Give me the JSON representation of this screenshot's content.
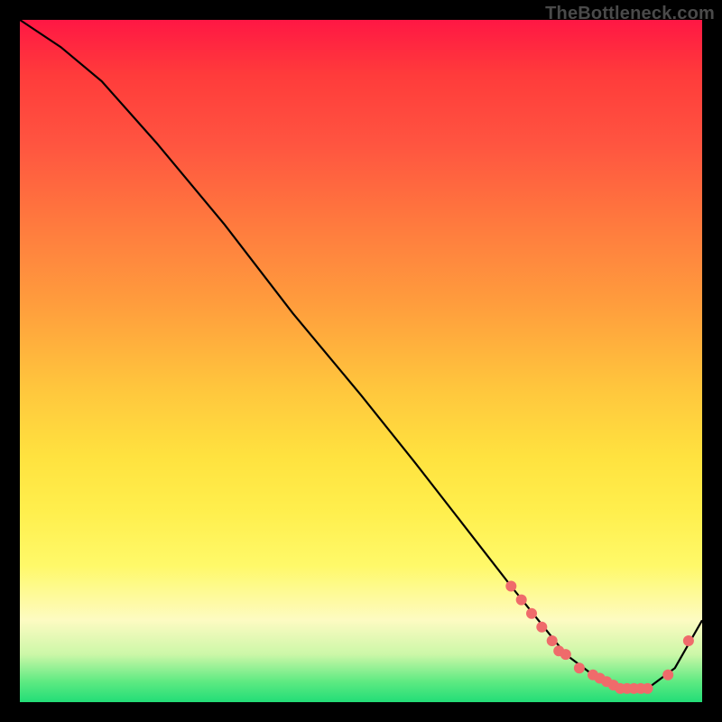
{
  "watermark": {
    "text": "TheBottleneck.com"
  },
  "chart_data": {
    "type": "line",
    "title": "",
    "xlabel": "",
    "ylabel": "",
    "xlim": [
      0,
      100
    ],
    "ylim": [
      0,
      100
    ],
    "series": [
      {
        "name": "curve",
        "x": [
          0,
          6,
          12,
          20,
          30,
          40,
          50,
          58,
          65,
          72,
          76,
          80,
          84,
          88,
          92,
          96,
          100
        ],
        "y": [
          100,
          96,
          91,
          82,
          70,
          57,
          45,
          35,
          26,
          17,
          12,
          7,
          4,
          2,
          2,
          5,
          12
        ]
      }
    ],
    "markers": [
      {
        "x": 72,
        "y": 17
      },
      {
        "x": 73.5,
        "y": 15
      },
      {
        "x": 75,
        "y": 13
      },
      {
        "x": 76.5,
        "y": 11
      },
      {
        "x": 78,
        "y": 9
      },
      {
        "x": 79,
        "y": 7.5
      },
      {
        "x": 80,
        "y": 7
      },
      {
        "x": 82,
        "y": 5
      },
      {
        "x": 84,
        "y": 4
      },
      {
        "x": 85,
        "y": 3.5
      },
      {
        "x": 86,
        "y": 3
      },
      {
        "x": 87,
        "y": 2.5
      },
      {
        "x": 88,
        "y": 2
      },
      {
        "x": 89,
        "y": 2
      },
      {
        "x": 90,
        "y": 2
      },
      {
        "x": 91,
        "y": 2
      },
      {
        "x": 92,
        "y": 2
      },
      {
        "x": 95,
        "y": 4
      },
      {
        "x": 98,
        "y": 9
      }
    ],
    "marker_color": "#ef6b6b",
    "line_color": "#000000",
    "background_gradient": [
      "#ff1744",
      "#ff5440",
      "#ff9e3d",
      "#ffe23f",
      "#fdfbc2",
      "#22dd77"
    ]
  }
}
